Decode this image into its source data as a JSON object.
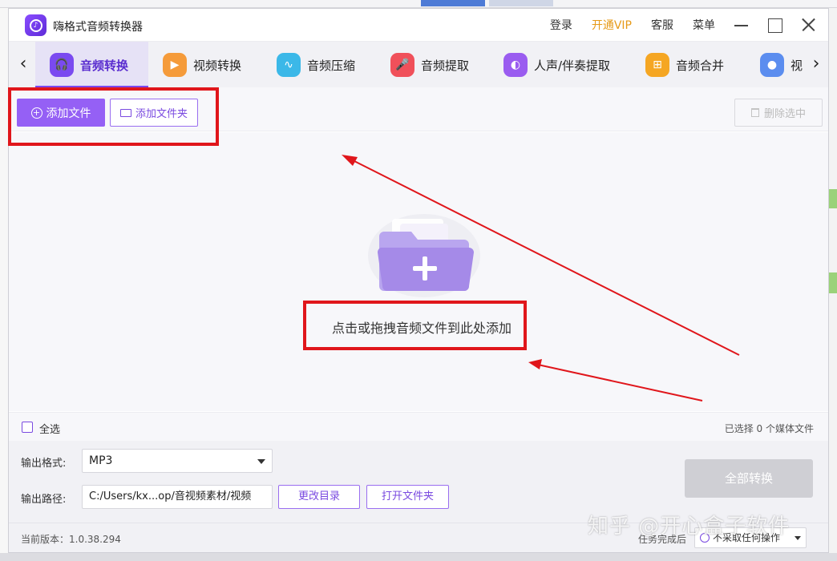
{
  "app": {
    "title": "嗨格式音频转换器",
    "menu": {
      "login": "登录",
      "vip": "开通VIP",
      "service": "客服",
      "menu": "菜单"
    }
  },
  "tabs": [
    {
      "label": "音频转换",
      "icon": "headphones-icon",
      "color": "#7a4af0",
      "active": true
    },
    {
      "label": "视频转换",
      "icon": "video-camera-icon",
      "color": "#f59b3a",
      "active": false
    },
    {
      "label": "音频压缩",
      "icon": "audio-wave-icon",
      "color": "#3bb8e8",
      "active": false
    },
    {
      "label": "音频提取",
      "icon": "microphone-icon",
      "color": "#f0505a",
      "active": false
    },
    {
      "label": "人声/伴奏提取",
      "icon": "voice-icon",
      "color": "#9a5cf0",
      "active": false
    },
    {
      "label": "音频合并",
      "icon": "merge-icon",
      "color": "#f5a623",
      "active": false
    },
    {
      "label": "视",
      "icon": "water-drop-icon",
      "color": "#5b8def",
      "active": false
    }
  ],
  "toolbar": {
    "add_file": "添加文件",
    "add_folder": "添加文件夹",
    "delete_selected": "删除选中"
  },
  "dropzone": {
    "hint": "点击或拖拽音频文件到此处添加"
  },
  "selection": {
    "select_all": "全选",
    "count_text": "已选择 0 个媒体文件"
  },
  "output": {
    "format_label": "输出格式:",
    "format_value": "MP3",
    "path_label": "输出路径:",
    "path_value": "C:/Users/kx...op/音视频素材/视频",
    "change_dir": "更改目录",
    "open_folder": "打开文件夹",
    "convert_all": "全部转换"
  },
  "status": {
    "version": "当前版本：1.0.38.294",
    "after_done_label": "任务完成后",
    "after_done_value": "不采取任何操作"
  },
  "watermark": "知乎 @开心盒子软件",
  "colors": {
    "accent": "#9560f5",
    "annotation": "#e0161b",
    "vip": "#e69a18"
  }
}
